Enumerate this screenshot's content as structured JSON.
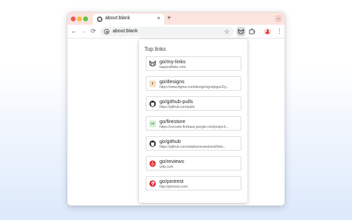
{
  "tab": {
    "title": "about:blank",
    "close": "×",
    "new_tab": "+",
    "search": "⌄"
  },
  "toolbar": {
    "back": "←",
    "forward": "→",
    "reload": "⟳",
    "url": "about:blank",
    "star": "☆",
    "menu": "⋮"
  },
  "popup": {
    "title": "Top links",
    "links": [
      {
        "shortcut": "go/my-links",
        "url": "laspondlinks.com",
        "icon": "raccoon-icon"
      },
      {
        "shortcut": "go/designs",
        "url": "https://www.figma.com/design/ogndjogucOy...",
        "icon": "figma-icon",
        "icon_text": "fi",
        "icon_color": "#f6e3c4"
      },
      {
        "shortcut": "go/github-pulls",
        "url": "https://github.com/pulls",
        "icon": "github-icon"
      },
      {
        "shortcut": "go/firestore",
        "url": "https://console.firebase.google.com/project/...",
        "icon": "firebase-icon",
        "icon_text": "co",
        "icon_color": "#d7f0d3"
      },
      {
        "shortcut": "go/github",
        "url": "https://github.com/stephenmanokivel/links...",
        "icon": "github-icon"
      },
      {
        "shortcut": "go/reviews",
        "url": "yelp.com",
        "icon": "yelp-icon",
        "icon_color": "#e0262b"
      },
      {
        "shortcut": "go/pintrest",
        "url": "http://pintrest.com/",
        "icon": "pinterest-icon",
        "icon_color": "#d31f27"
      }
    ]
  },
  "colors": {
    "tabstrip": "#fbe3de",
    "accent_red": "#d93025",
    "background_gradient_end": "#dce9fb"
  }
}
